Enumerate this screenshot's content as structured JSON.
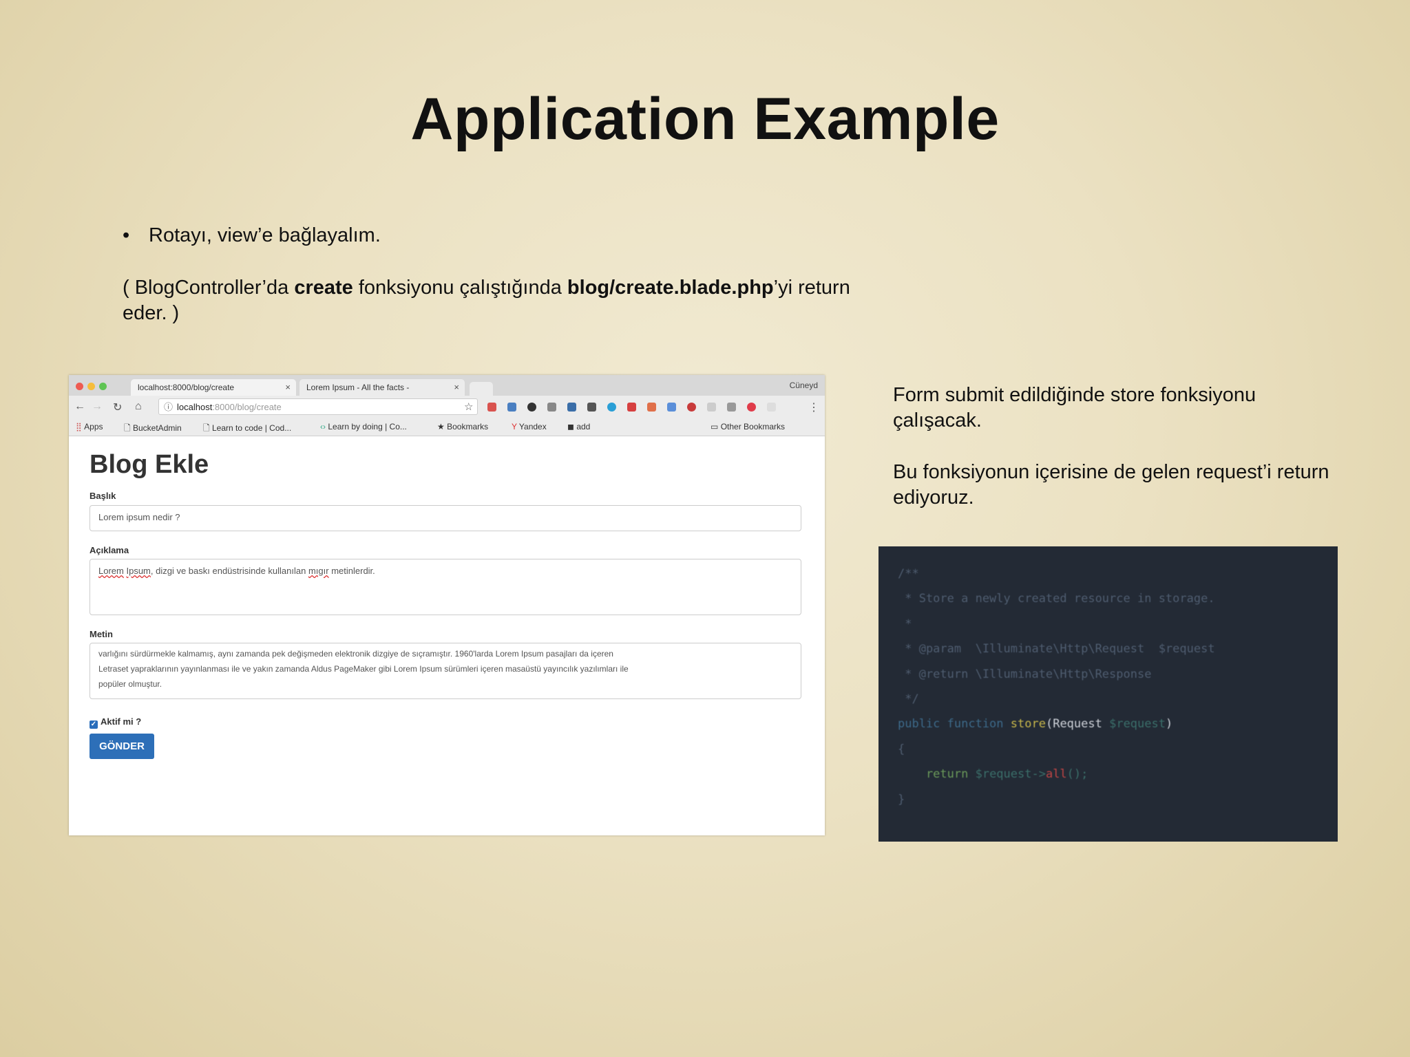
{
  "slide": {
    "title": "Application Example",
    "bullet": "Rotayı, view’e bağlayalım.",
    "note": {
      "part1": "( BlogController’da ",
      "bold1": "create",
      "part2": " fonksiyonu çalıştığında ",
      "bold2": "blog/create.blade.php",
      "part3": "’yi return eder. )"
    },
    "side_text_1": "Form submit edildiğinde store fonksiyonu çalışacak.",
    "side_text_2": "Bu fonksiyonun içerisine de gelen request’i return ediyoruz."
  },
  "browser": {
    "tabs": [
      {
        "label": "localhost:8000/blog/create",
        "close": "×"
      },
      {
        "label": "Lorem Ipsum - All the facts -",
        "close": "×"
      }
    ],
    "user": "Cüneyd",
    "url_host": "localhost",
    "url_path": ":8000/blog/create",
    "bookmarks": [
      "Apps",
      "BucketAdmin",
      "Learn to code | Cod...",
      "Learn by doing | Co...",
      "Bookmarks",
      "Yandex",
      "add"
    ],
    "other_bookmarks": "Other Bookmarks",
    "traffic_colors": [
      "#ee5b51",
      "#f6bd3b",
      "#5fc453"
    ]
  },
  "form": {
    "title": "Blog Ekle",
    "baslik_label": "Başlık",
    "baslik_value": "Lorem ipsum nedir ?",
    "aciklama_label": "Açıklama",
    "aciklama_value": {
      "w1": "Lorem",
      "w2": "Ipsum",
      "mid": ", dizgi ve baskı endüstrisinde kullanılan ",
      "w3": "mıgır",
      "end": " metinlerdir."
    },
    "metin_label": "Metin",
    "metin_lines": [
      "varlığını sürdürmekle kalmamış, aynı zamanda pek değişmeden elektronik dizgiye de sıçramıştır. 1960'larda Lorem Ipsum pasajları da içeren",
      "Letraset yapraklarının yayınlanması ile ve yakın zamanda Aldus PageMaker gibi Lorem Ipsum sürümleri içeren masaüstü yayıncılık yazılımları ile",
      "popüler olmuştur."
    ],
    "checkbox_label": "Aktif mi ?",
    "checkbox_checked": true,
    "submit_label": "GÖNDER"
  },
  "code": {
    "l1": "/**",
    "l2": " * Store a newly created resource in storage.",
    "l3": " *",
    "l4": " * @param  \\Illuminate\\Http\\Request  $request",
    "l5": " * @return \\Illuminate\\Http\\Response",
    "l6": " */",
    "l7_kw": "public function ",
    "l7_fn": "store",
    "l7_paren": "(",
    "l7_type": "Request ",
    "l7_var": "$request",
    "l7_close": ")",
    "l8": "{",
    "l9_ret": "    return ",
    "l9_var": "$request->",
    "l9_call": "all",
    "l9_end": "();",
    "l10": "}"
  }
}
